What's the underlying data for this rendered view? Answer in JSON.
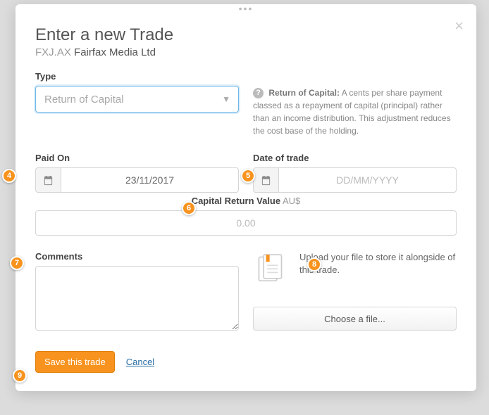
{
  "modal": {
    "title": "Enter a new Trade",
    "ticker": "FXJ.AX",
    "company": "Fairfax Media Ltd"
  },
  "type": {
    "label": "Type",
    "value": "Return of Capital",
    "help_title": "Return of Capital:",
    "help_body": "A cents per share payment classed as a repayment of capital (principal) rather than an income distribution. This adjustment reduces the cost base of the holding."
  },
  "paid_on": {
    "label": "Paid On",
    "value": "23/11/2017"
  },
  "date_of_trade": {
    "label": "Date of trade",
    "placeholder": "DD/MM/YYYY"
  },
  "capital_return": {
    "label": "Capital Return Value",
    "currency": "AU$",
    "placeholder": "0.00"
  },
  "comments": {
    "label": "Comments"
  },
  "upload": {
    "text": "Upload your file to store it alongside of this trade.",
    "button": "Choose a file..."
  },
  "footer": {
    "save": "Save this trade",
    "cancel": "Cancel"
  },
  "badges": {
    "b4": "4",
    "b5": "5",
    "b6": "6",
    "b7": "7",
    "b8": "8",
    "b9": "9"
  }
}
